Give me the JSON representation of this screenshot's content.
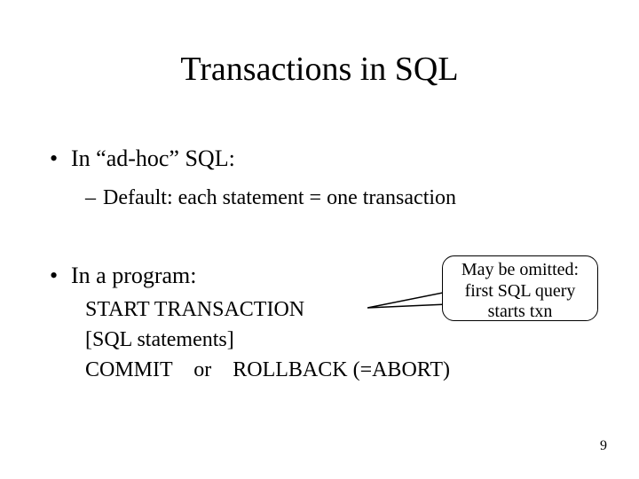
{
  "title": "Transactions in SQL",
  "bullets": {
    "adhoc": {
      "label": "In “ad-hoc” SQL:",
      "sub": "Default: each statement = one transaction"
    },
    "program": {
      "label": "In a program:",
      "lines": {
        "l1": "START TRANSACTION",
        "l2": "[SQL statements]",
        "l3": "COMMIT    or    ROLLBACK (=ABORT)"
      }
    }
  },
  "callout": {
    "line1": "May be omitted:",
    "line2": "first SQL query",
    "line3": "starts txn"
  },
  "slide_number": "9",
  "glyphs": {
    "bullet": "•",
    "dash": "–"
  }
}
